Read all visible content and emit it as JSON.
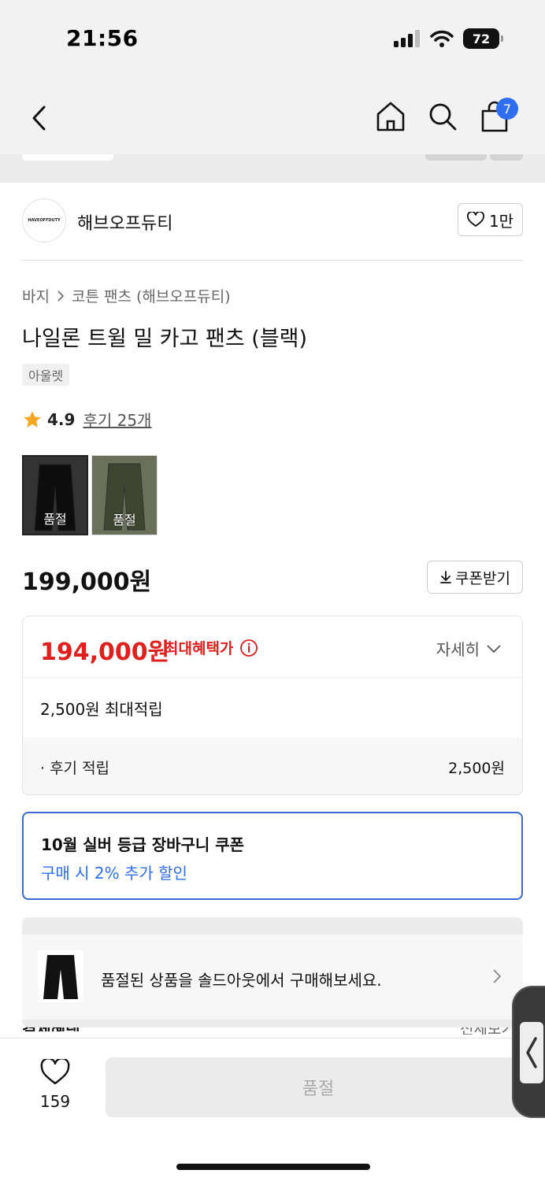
{
  "status": {
    "time": "21:56",
    "battery": "72"
  },
  "nav": {
    "cart_count": "7"
  },
  "brand": {
    "name": "해브오프듀티",
    "logo_text": "HAVEOFFDUTY",
    "likes": "1만"
  },
  "breadcrumb": {
    "category": "바지",
    "sub": "코튼 팬츠 (해브오프듀티)"
  },
  "product": {
    "title": "나일론 트윌 밀 카고 팬츠 (블랙)",
    "tag": "아울렛",
    "rating": "4.9",
    "reviews": "후기 25개",
    "thumbs": [
      {
        "label": "품절"
      },
      {
        "label": "품절"
      }
    ],
    "price": "199,000원",
    "coupon_button": "쿠폰받기"
  },
  "benefit": {
    "best_price": "194,000원",
    "best_label": "최대혜택가",
    "detail_toggle": "자세히",
    "points": "2,500원 최대적립",
    "review_points_label": "· 후기 적립",
    "review_points_value": "2,500원"
  },
  "coupon": {
    "title": "10월 실버 등급 장바구니 쿠폰",
    "sub": "구매 시 2% 추가 할인"
  },
  "soldout": {
    "text": "품절된 상품을 솔드아웃에서 구매해보세요."
  },
  "payment": {
    "label": "결제혜택",
    "view_all": "전체보기"
  },
  "bottom": {
    "wish_count": "159",
    "buy_label": "품절"
  },
  "colors": {
    "accent_red": "#e0201f",
    "accent_blue": "#2f6ef0"
  }
}
